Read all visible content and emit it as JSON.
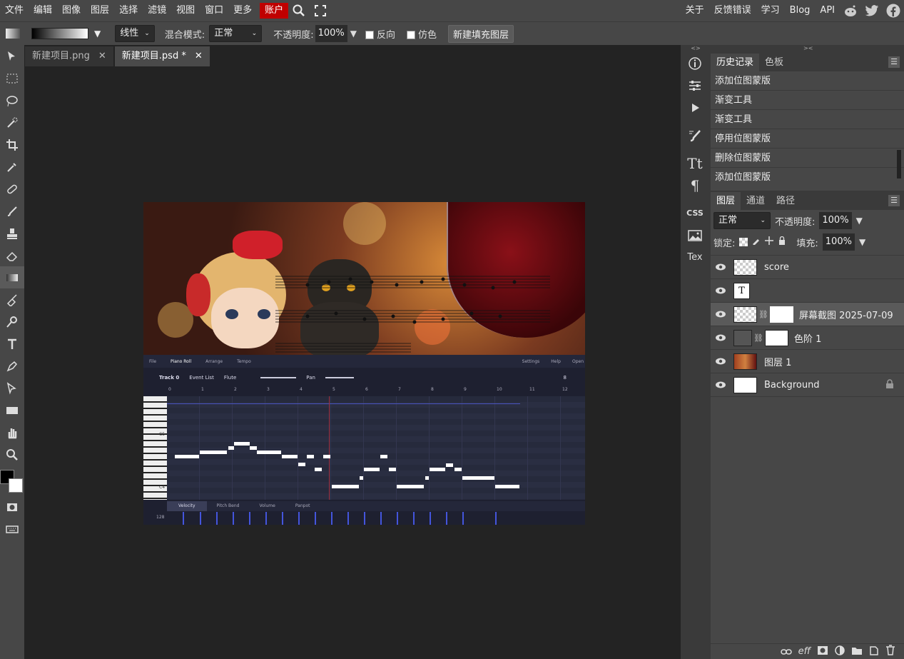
{
  "menubar": {
    "items": [
      "文件",
      "编辑",
      "图像",
      "图层",
      "选择",
      "滤镜",
      "视图",
      "窗口",
      "更多",
      "账户"
    ],
    "right_items": [
      "关于",
      "反馈错误",
      "学习",
      "Blog",
      "API"
    ]
  },
  "options": {
    "gradient_type": "线性",
    "blend_label": "混合模式:",
    "blend_value": "正常",
    "opacity_label": "不透明度:",
    "opacity_value": "100%",
    "reverse_label": "反向",
    "dither_label": "仿色",
    "new_fill_layer": "新建填充图层"
  },
  "tabs": [
    {
      "label": "新建项目.png",
      "close": "✕"
    },
    {
      "label": "新建项目.psd *",
      "close": "✕"
    }
  ],
  "sidepanel": {
    "css_label": "CSS",
    "tex_label": "Tex"
  },
  "history": {
    "tabs": [
      "历史记录",
      "色板"
    ],
    "items": [
      "添加位图蒙版",
      "渐变工具",
      "渐变工具",
      "停用位图蒙版",
      "删除位图蒙版",
      "添加位图蒙版"
    ]
  },
  "layers_panel": {
    "tabs": [
      "图层",
      "通道",
      "路径"
    ],
    "blend_value": "正常",
    "opacity_label": "不透明度:",
    "opacity_value": "100%",
    "lock_label": "锁定:",
    "fill_label": "填充:",
    "fill_value": "100%",
    "layers": [
      {
        "name": "score"
      },
      {
        "name": ""
      },
      {
        "name": "屏幕截图 2025-07-09 1"
      },
      {
        "name": "色阶 1"
      },
      {
        "name": "图层 1"
      },
      {
        "name": "Background"
      }
    ]
  },
  "piano_roll": {
    "tabs": [
      "File",
      "Piano Roll",
      "Arrange",
      "Tempo"
    ],
    "right_tabs": [
      "Settings",
      "Help",
      "Open"
    ],
    "track": "Track 0",
    "event_list": "Event List",
    "instrument": "Flute",
    "pan": "Pan",
    "quant": "8",
    "ruler": [
      "0",
      "1",
      "2",
      "3",
      "4",
      "5",
      "6",
      "7",
      "8",
      "9",
      "10",
      "11",
      "12"
    ],
    "key_c5": "C5",
    "key_c4": "C4",
    "bottom_tabs": [
      "Velocity",
      "Pitch Bend",
      "Volume",
      "Panpot"
    ],
    "vel_max": "128"
  },
  "colors": {
    "accent": "#c00000",
    "panel": "#474747",
    "workspace": "#232323"
  }
}
